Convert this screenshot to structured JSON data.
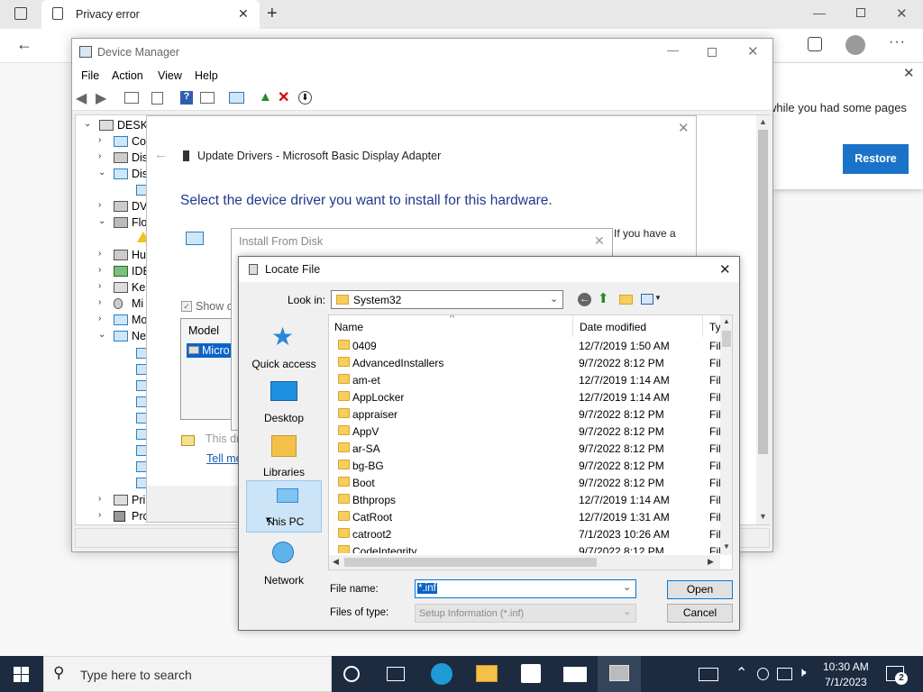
{
  "browser": {
    "tab_title": "Privacy error",
    "restore_message": "while you had some pages",
    "restore_button": "Restore"
  },
  "device_manager": {
    "title": "Device Manager",
    "menu": [
      "File",
      "Action",
      "View",
      "Help"
    ],
    "tree_root": "DESKT",
    "tree_items": [
      "Co",
      "Dis",
      "Dis",
      "DV",
      "Flo",
      "Hu",
      "IDE",
      "Ke",
      "Mi",
      "Mo",
      "Ne",
      "Pri",
      "Pro"
    ]
  },
  "update_drivers": {
    "title": "Update Drivers - Microsoft Basic Display Adapter",
    "heading": "Select the device driver you want to install for this hardware.",
    "side_text": "If you have a",
    "show_compatible": "Show co",
    "model_header": "Model",
    "model_selected": "Micro",
    "signed_text": "This dr",
    "tell_me_link": "Tell me"
  },
  "install_from_disk": {
    "title": "Install From Disk"
  },
  "locate_file": {
    "title": "Locate File",
    "look_in_label": "Look in:",
    "look_in_value": "System32",
    "places": [
      "Quick access",
      "Desktop",
      "Libraries",
      "This PC",
      "Network"
    ],
    "columns": {
      "name": "Name",
      "date": "Date modified",
      "type": "Ty"
    },
    "files": [
      {
        "name": "0409",
        "date": "12/7/2019 1:50 AM",
        "type": "Fil"
      },
      {
        "name": "AdvancedInstallers",
        "date": "9/7/2022 8:12 PM",
        "type": "Fil"
      },
      {
        "name": "am-et",
        "date": "12/7/2019 1:14 AM",
        "type": "Fil"
      },
      {
        "name": "AppLocker",
        "date": "12/7/2019 1:14 AM",
        "type": "Fil"
      },
      {
        "name": "appraiser",
        "date": "9/7/2022 8:12 PM",
        "type": "Fil"
      },
      {
        "name": "AppV",
        "date": "9/7/2022 8:12 PM",
        "type": "Fil"
      },
      {
        "name": "ar-SA",
        "date": "9/7/2022 8:12 PM",
        "type": "Fil"
      },
      {
        "name": "bg-BG",
        "date": "9/7/2022 8:12 PM",
        "type": "Fil"
      },
      {
        "name": "Boot",
        "date": "9/7/2022 8:12 PM",
        "type": "Fil"
      },
      {
        "name": "Bthprops",
        "date": "12/7/2019 1:14 AM",
        "type": "Fil"
      },
      {
        "name": "CatRoot",
        "date": "12/7/2019 1:31 AM",
        "type": "Fil"
      },
      {
        "name": "catroot2",
        "date": "7/1/2023 10:26 AM",
        "type": "Fil"
      },
      {
        "name": "CodeIntegrity",
        "date": "9/7/2022 8:12 PM",
        "type": "Fil"
      }
    ],
    "file_name_label": "File name:",
    "file_name_value": "*.inf",
    "files_of_type_label": "Files of type:",
    "files_of_type_value": "Setup Information (*.inf)",
    "open_button": "Open",
    "cancel_button": "Cancel"
  },
  "taskbar": {
    "search_placeholder": "Type here to search",
    "time": "10:30 AM",
    "date": "7/1/2023",
    "notification_count": "2"
  }
}
